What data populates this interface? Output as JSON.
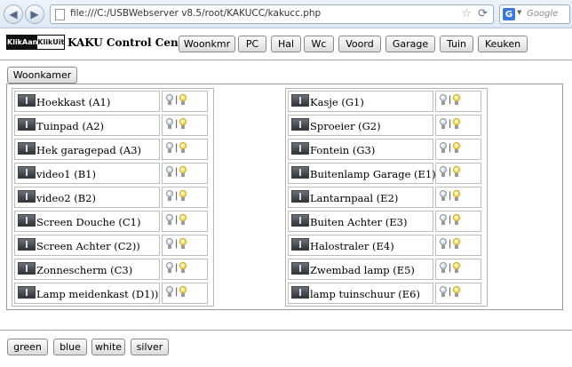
{
  "browser": {
    "url": "file:///C:/USBWebserver v8.5/root/KAKUCC/kakucc.php",
    "search_placeholder": "Google",
    "search_engine_letter": "G"
  },
  "header": {
    "logo_left": "KlikAan",
    "logo_right": "KlikUit",
    "title": "KAKU Control Center",
    "nav": [
      "Woonkmr",
      "PC",
      "Hal",
      "Wc",
      "Voord",
      "Garage",
      "Tuin",
      "Keuken"
    ]
  },
  "room": {
    "title": "Woonkamer",
    "left_devices": [
      "Hoekkast (A1)",
      "Tuinpad (A2)",
      "Hek garagepad (A3)",
      "video1 (B1)",
      "video2 (B2)",
      "Screen Douche (C1)",
      "Screen Achter (C2))",
      "Zonnescherm (C3)",
      "Lamp meidenkast (D1))"
    ],
    "right_devices": [
      "Kasje (G1)",
      "Sproeier (G2)",
      "Fontein (G3)",
      "Buitenlamp Garage (E1)",
      "Lantarnpaal (E2)",
      "Buiten Achter (E3)",
      "Halostraler (E4)",
      "Zwembad lamp (E5)",
      "lamp tuinschuur (E6)"
    ],
    "separator": "|"
  },
  "themes": [
    "green",
    "blue",
    "white",
    "silver"
  ],
  "colors": {
    "bulb_on": "#f3d23b",
    "bulb_off": "#b9c0c8",
    "page_bg": "#ffffff"
  }
}
